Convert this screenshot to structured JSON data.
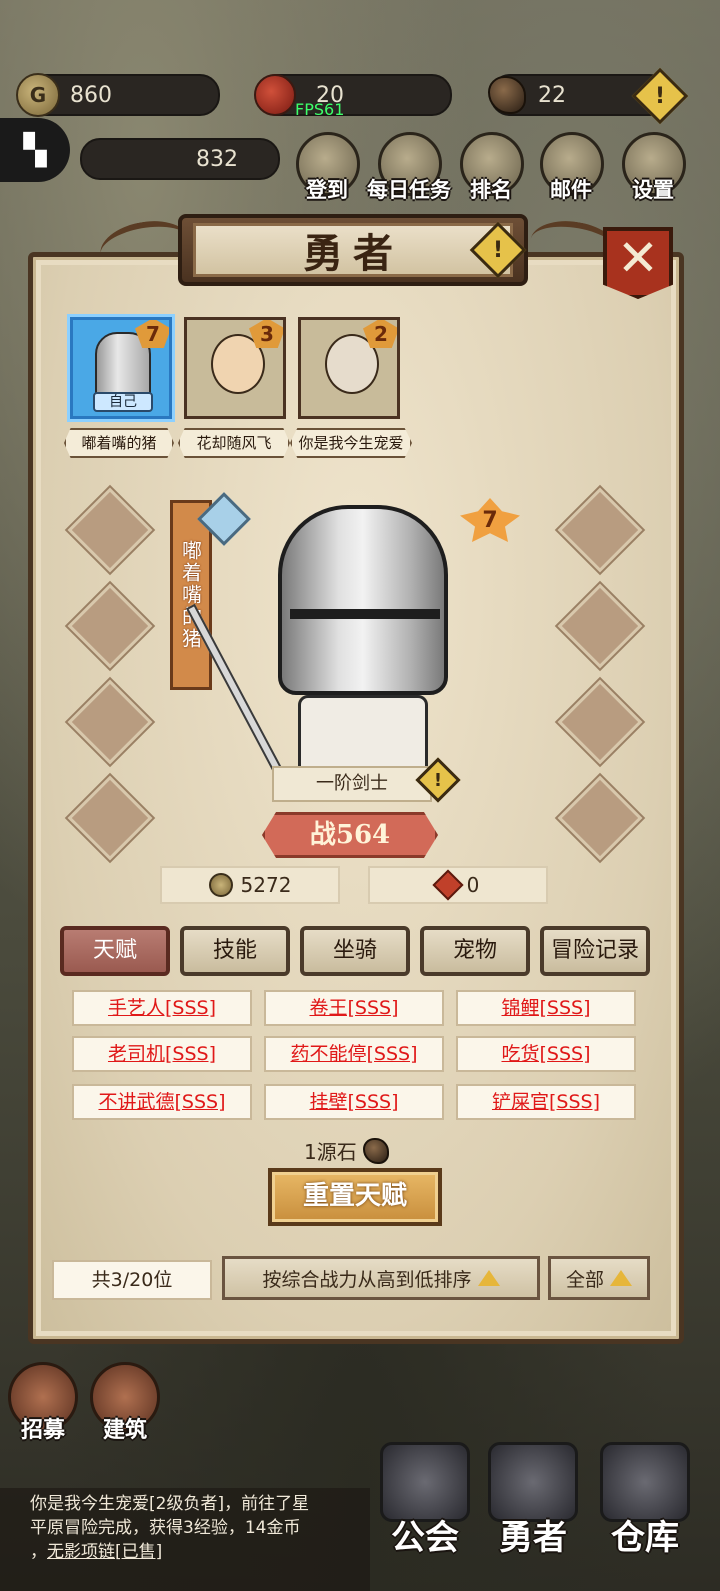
{
  "resources": {
    "gold": "860",
    "gems": "20",
    "stones": "22",
    "second_value": "832",
    "fps": "FPS61"
  },
  "top_buttons": [
    "登到",
    "每日任务",
    "排名",
    "邮件",
    "设置"
  ],
  "panel": {
    "title": "勇者",
    "close_label": "✕",
    "alert_label": "!"
  },
  "heroes": [
    {
      "name": "嘟着嘴的猪",
      "level": "7",
      "tag": "自己"
    },
    {
      "name": "花却随风飞",
      "level": "3"
    },
    {
      "name": "你是我今生宠爱",
      "level": "2"
    }
  ],
  "selected_hero": {
    "banner_name": "嘟着嘴的猪",
    "star_level": "7",
    "rank": "一阶剑士",
    "power": "战564",
    "gold": "5272",
    "tokens": "0"
  },
  "tabs": [
    "天赋",
    "技能",
    "坐骑",
    "宠物",
    "冒险记录"
  ],
  "active_tab": 0,
  "talents": [
    "手艺人[SSS]",
    "卷王[SSS]",
    "锦鲤[SSS]",
    "老司机[SSS]",
    "药不能停[SSS]",
    "吃货[SSS]",
    "不讲武德[SSS]",
    "挂壁[SSS]",
    "铲屎官[SSS]"
  ],
  "reset": {
    "cost": "1源石",
    "button": "重置天赋"
  },
  "footer": {
    "count": "共3/20位",
    "sort": "按综合战力从高到低排序",
    "filter": "全部"
  },
  "side_buttons": [
    "招募",
    "建筑"
  ],
  "log": {
    "line1": "你是我今生宠爱[2级负者]，前往了星",
    "line2": "平原冒险完成，获得3经验，14金币",
    "line3_prefix": "，",
    "line3_item": "无影项链[已售]"
  },
  "bottom_nav": [
    "公会",
    "勇者",
    "仓库"
  ]
}
